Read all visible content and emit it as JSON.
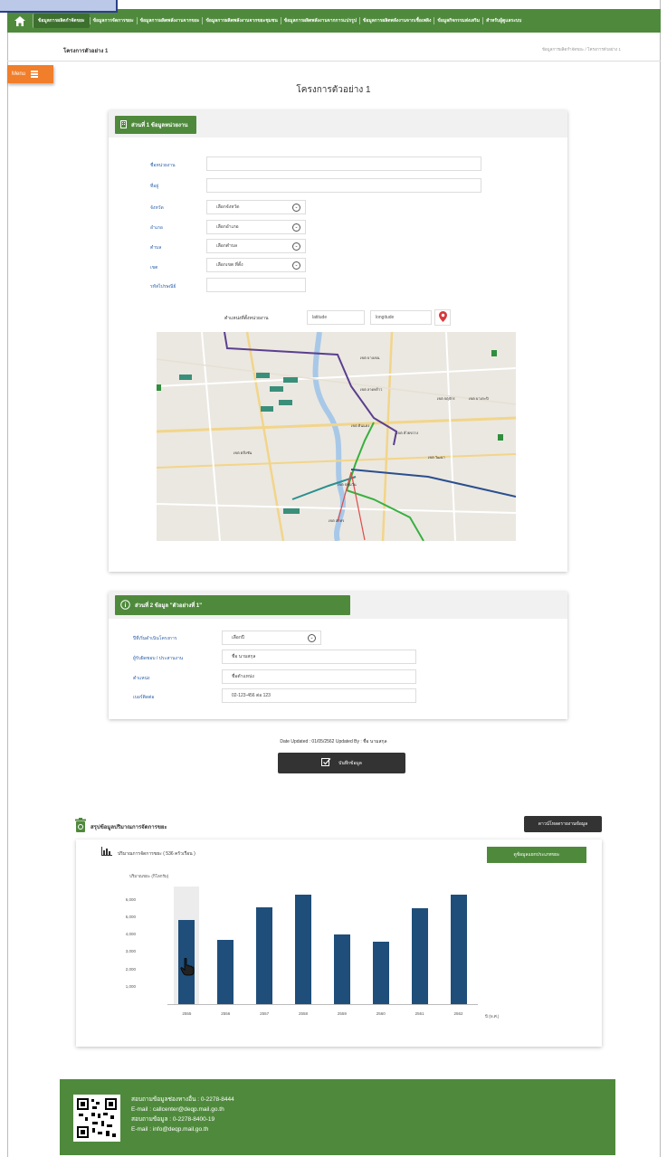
{
  "nav": {
    "items": [
      "ข้อมูลการผลิตกำจัดขยะ",
      "ข้อมูลการจัดการขยะ",
      "ข้อมูลการผลิตพลังงานจากขยะ",
      "ข้อมูลการผลิตพลังงานจากขยะชุมชน",
      "ข้อมูลการผลิตพลังงานจากการแปรรูป",
      "ข้อมูลการผลิตพลังงานจากเชื้อเพลิง",
      "ข้อมูลกิจกรรมส่งเสริม",
      "สำหรับผู้ดูแลระบบ"
    ]
  },
  "subbar": {
    "title": "โครงการตัวอย่าง 1",
    "breadcrumb": "ข้อมูลการผลิตกำจัดขยะ / โครงการตัวอย่าง 1"
  },
  "menu": {
    "label": "Menu"
  },
  "page": {
    "title": "โครงการตัวอย่าง 1"
  },
  "section1": {
    "title": "ส่วนที่ 1 ข้อมูลหน่วยงาน",
    "labels": {
      "org": "ชื่อหน่วยงาน",
      "address": "ที่อยู่",
      "province": "จังหวัด",
      "district": "อำเภอ",
      "subdistrict": "ตำบล",
      "area": "เขต",
      "postcode": "รหัสไปรษณีย์"
    },
    "selects": {
      "province": "เลือกจังหวัด",
      "district": "เลือกอำเภอ",
      "subdistrict": "เลือกตำบล",
      "area": "เลือกเขต ที่ตั้ง"
    },
    "location_label": "ตำแหน่งที่ตั้งหน่วยงาน",
    "latitude_placeholder": "latitude",
    "longitude_placeholder": "longitude"
  },
  "map": {
    "labels": [
      "เขต บางเขน",
      "เขต ลาดพร้าว",
      "เขต บางกะปิ",
      "เขต จตุจักร",
      "เขต ดินแดง",
      "เขต ห้วยขวาง",
      "เขต ตลิ่งชัน",
      "เขต ปทุมวัน",
      "เขต วัฒนา",
      "เขต สาทร"
    ]
  },
  "section2": {
    "title": "ส่วนที่ 2 ข้อมูล \"ตัวอย่างที่ 1\"",
    "labels": {
      "period": "ปีที่เริ่มดำเนินโครงการ",
      "contact": "ผู้รับผิดชอบ / ประสานงาน",
      "position": "ตำแหน่ง",
      "phone": "เบอร์ติดต่อ"
    },
    "values": {
      "period": "เลือกปี",
      "contact": "ชื่อ นามสกุล",
      "position": "ชื่อตำแหน่ง",
      "phone": "02-123-456 ต่อ 123"
    }
  },
  "update": {
    "text": "Date Updated : 01/05/2562   Updated By : ชื่อ นามสกุล",
    "save_label": "บันทึกข้อมูล"
  },
  "summary": {
    "title": "สรุปข้อมูลปริมาณการจัดการขยะ",
    "export_label": "ดาวน์โหลดรายงานข้อมูล",
    "chart_title": "ปริมาณการจัดการขยะ ( 536 ครัวเรือน )",
    "compare_label": "ดูข้อมูลแยกประเภทขยะ"
  },
  "chart_data": {
    "type": "bar",
    "ylabel": "ปริมาณขยะ (กิโลกรัม)",
    "xlabel": "ปี (พ.ศ.)",
    "categories": [
      "2555",
      "2556",
      "2557",
      "2558",
      "2559",
      "2560",
      "2561",
      "2562"
    ],
    "values": [
      4850,
      3700,
      5550,
      6300,
      4000,
      3600,
      5500,
      6300
    ],
    "yticks": [
      "6,000",
      "5,000",
      "4,000",
      "3,000",
      "2,000",
      "1,000"
    ],
    "ylim": [
      0,
      6500
    ],
    "bar_color": "#1f4e7a",
    "highlight_index": 0
  },
  "footer": {
    "lines": [
      "สอบถามข้อมูลช่องทางอื่น : 0-2278-8444",
      "E-mail : callcenter@deqp.mail.go.th",
      "สอบถามข้อมูล : 0-2278-8400-19",
      "E-mail : info@deqp.mail.go.th"
    ]
  }
}
